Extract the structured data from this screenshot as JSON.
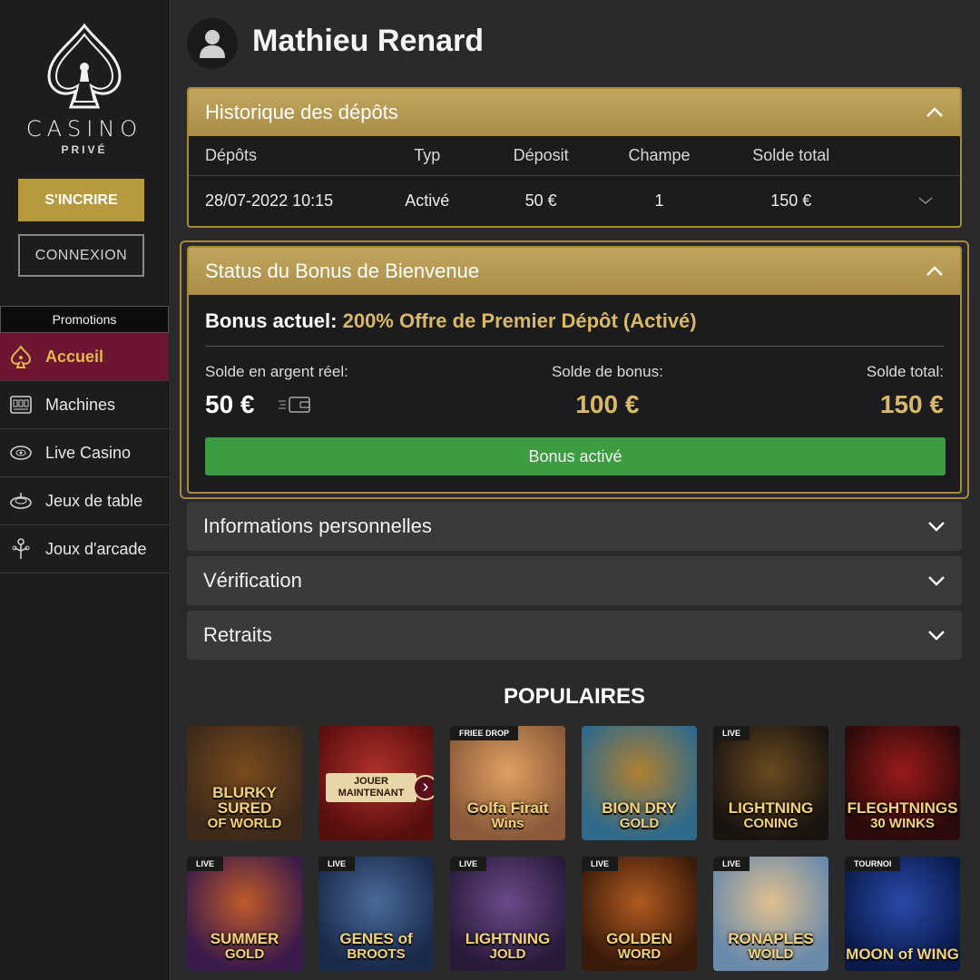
{
  "brand": {
    "name": "CASINO",
    "sub": "PRIVÉ"
  },
  "sidebar": {
    "signup_label": "S'INCRIRE",
    "login_label": "CONNEXION",
    "promotions_label": "Promotions",
    "items": [
      {
        "label": "Accueil",
        "icon": "home-icon",
        "active": true
      },
      {
        "label": "Machines",
        "icon": "slot-machine-icon"
      },
      {
        "label": "Live Casino",
        "icon": "chip-icon"
      },
      {
        "label": "Jeux de table",
        "icon": "roulette-icon"
      },
      {
        "label": "Joux d'arcade",
        "icon": "arcade-icon"
      }
    ]
  },
  "user": {
    "name": "Mathieu Renard"
  },
  "deposits": {
    "title": "Historique des dépôts",
    "columns": [
      "Dépôts",
      "Typ",
      "Déposit",
      "Champe",
      "Solde total"
    ],
    "rows": [
      {
        "date": "28/07-2022 10:15",
        "type": "Activé",
        "deposit": "50 €",
        "champe": "1",
        "total": "150 €"
      }
    ]
  },
  "bonus": {
    "title": "Status du Bonus de Bienvenue",
    "current_label": "Bonus actuel:",
    "current_value": "200% Offre de Premier Dépôt (Activé)",
    "real_label": "Solde en argent réel:",
    "real_value": "50 €",
    "bonus_label": "Solde de bonus:",
    "bonus_value": "100 €",
    "total_label": "Solde total:",
    "total_value": "150 €",
    "button_label": "Bonus activé"
  },
  "accordions": [
    "Informations personnelles",
    "Vérification",
    "Retraits"
  ],
  "popular": {
    "title": "POPULAIRES",
    "games": [
      {
        "title": "BLURKY SURED",
        "sub": "OF WORLD",
        "badge": "",
        "colors": [
          "#3d2a1a",
          "#7a4a1c"
        ]
      },
      {
        "title": "",
        "sub": "",
        "badge": "",
        "cta": "JOUER MAINTENANT",
        "colors": [
          "#5a0f0f",
          "#b0302a"
        ]
      },
      {
        "title": "Golfa Firait",
        "sub": "Wins",
        "badge": "FRIEE DROP",
        "colors": [
          "#8a5a3a",
          "#e0a060"
        ]
      },
      {
        "title": "BION DRY",
        "sub": "GOLD",
        "badge": "",
        "colors": [
          "#2f6a8a",
          "#b08030"
        ]
      },
      {
        "title": "LIGHTNING",
        "sub": "CONING",
        "badge": "LIVE",
        "colors": [
          "#1a1410",
          "#6a4a20"
        ]
      },
      {
        "title": "FLEGHTNINGS",
        "sub": "30 WINKS",
        "badge": "",
        "colors": [
          "#2a0a0a",
          "#9a1a1a"
        ]
      },
      {
        "title": "SUMMER",
        "sub": "GOLD",
        "badge": "LIVE",
        "colors": [
          "#3a1a4a",
          "#c05a2a"
        ]
      },
      {
        "title": "GENES of",
        "sub": "BROOTS",
        "badge": "LIVE",
        "colors": [
          "#1a2a4a",
          "#4a6a9a"
        ]
      },
      {
        "title": "LIGHTNING",
        "sub": "JOLD",
        "badge": "LIVE",
        "colors": [
          "#2a1a3a",
          "#6a4a8a"
        ]
      },
      {
        "title": "GOLDEN",
        "sub": "WORD",
        "badge": "LIVE",
        "colors": [
          "#3a1a0a",
          "#b05a20"
        ]
      },
      {
        "title": "RONAPLES",
        "sub": "WOILD",
        "badge": "LIVE",
        "colors": [
          "#6a8aaa",
          "#e0c090"
        ]
      },
      {
        "title": "MOON of WING",
        "sub": "",
        "badge": "TOURNOI",
        "colors": [
          "#0a1a4a",
          "#2a4aaa"
        ]
      }
    ]
  }
}
